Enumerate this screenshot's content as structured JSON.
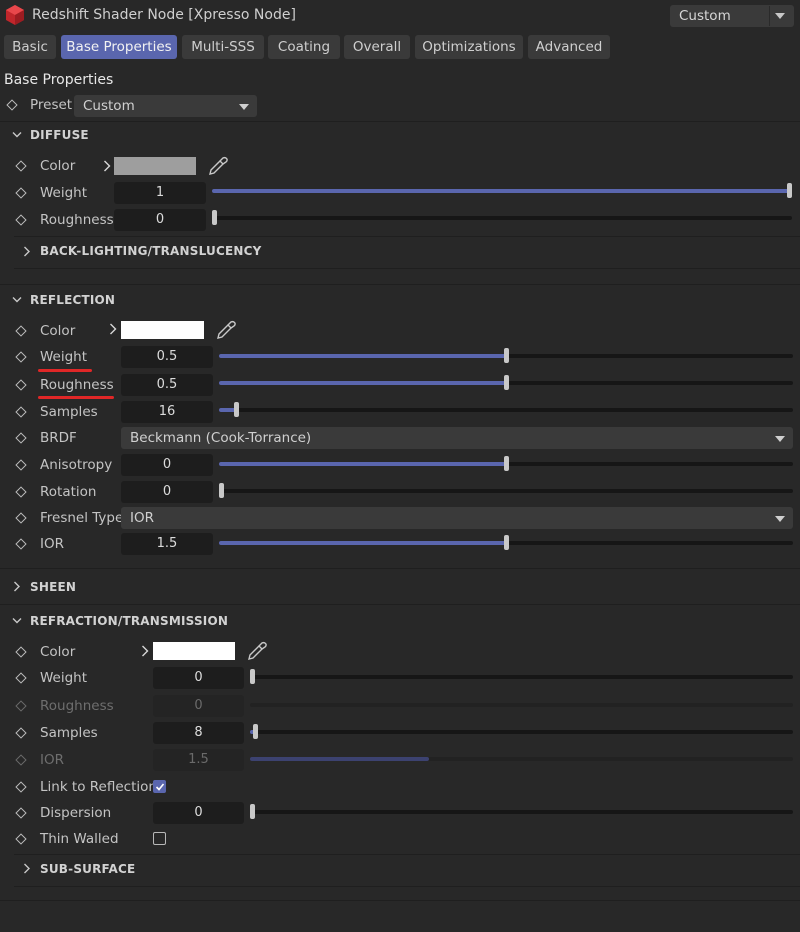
{
  "window": {
    "title": "Redshift Shader Node [Xpresso Node]",
    "mode": "Custom"
  },
  "tabs": [
    {
      "label": "Basic",
      "active": false
    },
    {
      "label": "Base Properties",
      "active": true
    },
    {
      "label": "Multi-SSS",
      "active": false
    },
    {
      "label": "Coating",
      "active": false
    },
    {
      "label": "Overall",
      "active": false
    },
    {
      "label": "Optimizations",
      "active": false
    },
    {
      "label": "Advanced",
      "active": false
    }
  ],
  "panel": {
    "heading": "Base Properties",
    "preset_label": "Preset",
    "preset_value": "Custom"
  },
  "diffuse": {
    "title": "DIFFUSE",
    "color_label": "Color",
    "color": "#9e9e9e",
    "weight_label": "Weight",
    "weight": "1",
    "weight_fraction": 1.0,
    "roughness_label": "Roughness",
    "roughness": "0",
    "roughness_fraction": 0.0,
    "backlighting_title": "BACK-LIGHTING/TRANSLUCENCY"
  },
  "reflection": {
    "title": "REFLECTION",
    "color_label": "Color",
    "color": "#ffffff",
    "weight_label": "Weight",
    "weight": "0.5",
    "weight_fraction": 0.5,
    "roughness_label": "Roughness",
    "roughness": "0.5",
    "roughness_fraction": 0.5,
    "samples_label": "Samples",
    "samples": "16",
    "samples_fraction": 0.03,
    "brdf_label": "BRDF",
    "brdf": "Beckmann (Cook-Torrance)",
    "anisotropy_label": "Anisotropy",
    "anisotropy": "0",
    "anisotropy_fraction": 0.5,
    "rotation_label": "Rotation",
    "rotation": "0",
    "rotation_fraction": 0.0,
    "fresnel_label": "Fresnel Type",
    "fresnel": "IOR",
    "ior_label": "IOR",
    "ior": "1.5",
    "ior_fraction": 0.5
  },
  "sheen": {
    "title": "SHEEN"
  },
  "refraction": {
    "title": "REFRACTION/TRANSMISSION",
    "color_label": "Color",
    "color": "#ffffff",
    "weight_label": "Weight",
    "weight": "0",
    "weight_fraction": 0.0,
    "roughness_label": "Roughness",
    "roughness": "0",
    "samples_label": "Samples",
    "samples": "8",
    "samples_fraction": 0.01,
    "ior_label": "IOR",
    "ior": "1.5",
    "ior_fraction": 0.33,
    "link_label": "Link to Reflection",
    "link_checked": true,
    "dispersion_label": "Dispersion",
    "dispersion": "0",
    "dispersion_fraction": 0.0,
    "thin_label": "Thin Walled",
    "thin_checked": false
  },
  "subsurface": {
    "title": "SUB-SURFACE"
  },
  "colors": {
    "accent": "#5a66ae",
    "annotation": "#e02727"
  }
}
